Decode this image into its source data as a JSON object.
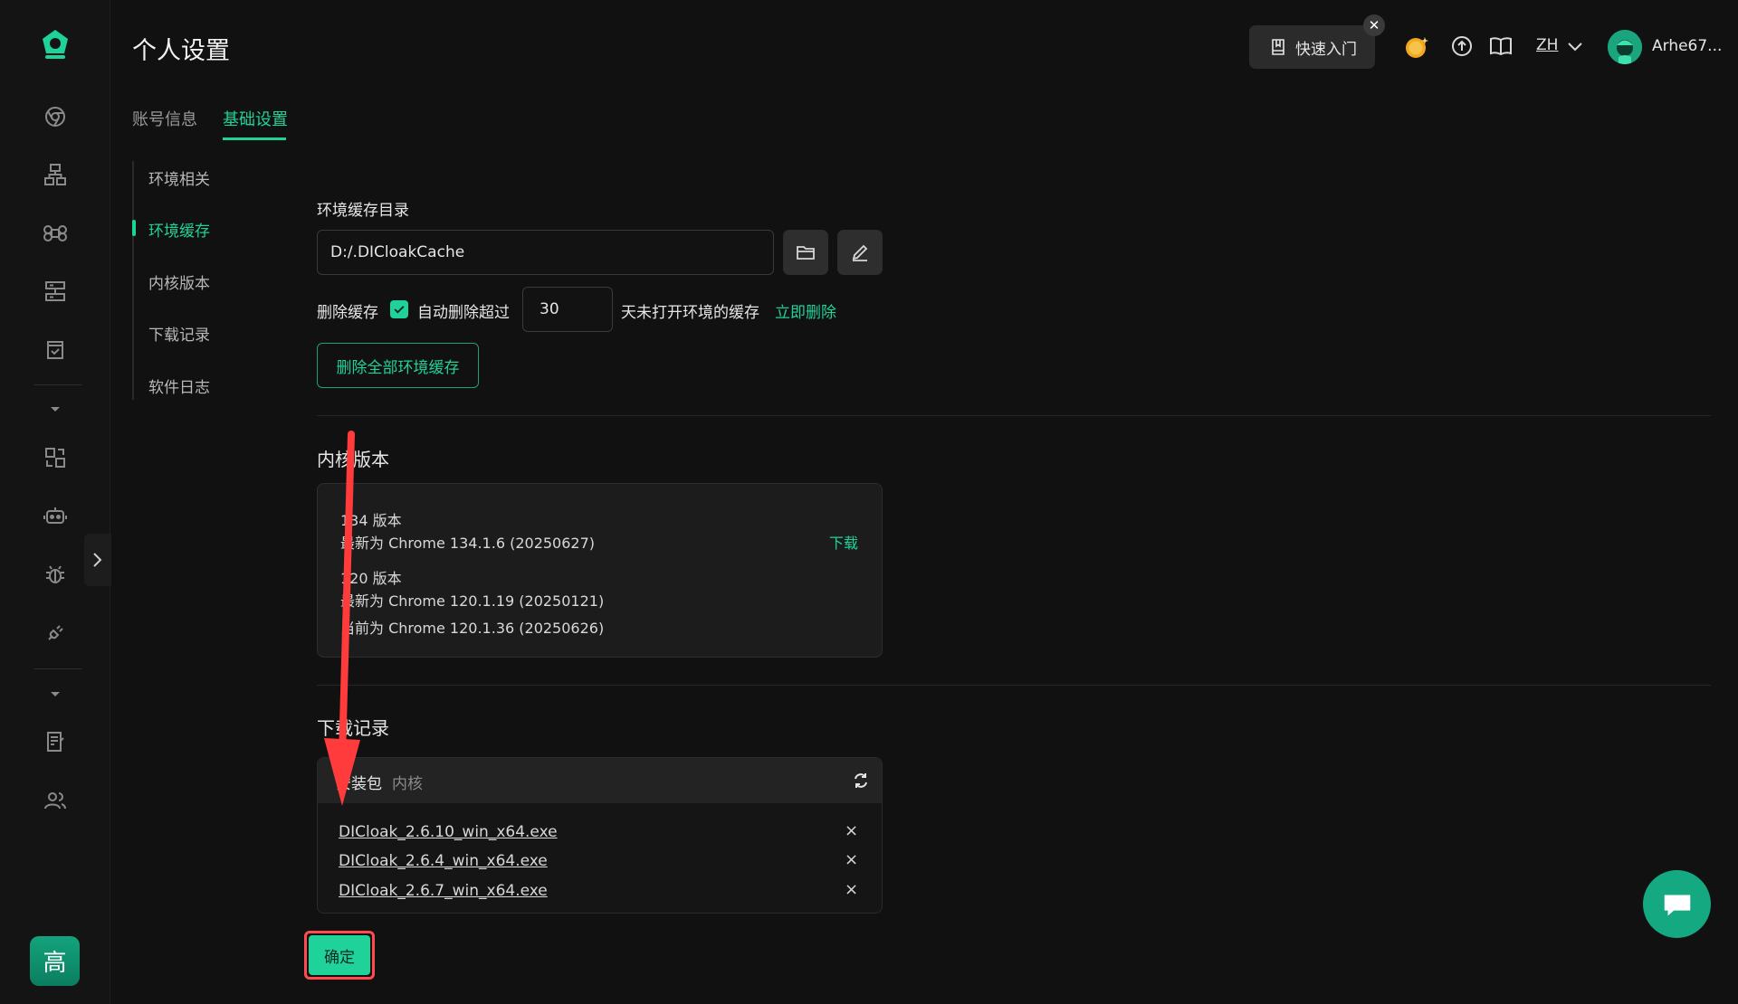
{
  "app": {
    "page_title": "个人设置",
    "accent_color": "#1fd29a",
    "alert_color": "#ff4b4b"
  },
  "rail": {
    "icons": [
      "logo-icon",
      "browser-icon",
      "network-icon",
      "command-icon",
      "server-icon",
      "shop-icon",
      "caret-down-icon",
      "sync-icon",
      "robot-icon",
      "bug-icon",
      "plug-icon",
      "caret-down-icon",
      "notes-icon",
      "team-icon"
    ],
    "user_initial": "高"
  },
  "header": {
    "quick_start": "快速入门",
    "quick_close": "✕",
    "language": "ZH",
    "username": "Arhe67..."
  },
  "tabs": [
    {
      "label": "账号信息",
      "active": false
    },
    {
      "label": "基础设置",
      "active": true
    }
  ],
  "subnav": [
    {
      "label": "环境相关",
      "active": false
    },
    {
      "label": "环境缓存",
      "active": true
    },
    {
      "label": "内核版本",
      "active": false
    },
    {
      "label": "下载记录",
      "active": false
    },
    {
      "label": "软件日志",
      "active": false
    }
  ],
  "cache": {
    "dir_label": "环境缓存目录",
    "dir_value": "D:/.DICloakCache",
    "delete_label": "删除缓存",
    "auto_delete_checked": true,
    "auto_delete_label": "自动删除超过",
    "days_value": "30",
    "days_suffix": "天未打开环境的缓存",
    "delete_now": "立即删除",
    "delete_all": "删除全部环境缓存"
  },
  "kernel": {
    "title": "内核版本",
    "versions": [
      {
        "name": "134 版本",
        "latest": "最新为 Chrome 134.1.6 (20250627)",
        "action": "下载"
      },
      {
        "name": "120 版本",
        "latest": "最新为 Chrome 120.1.19 (20250121)",
        "current": "当前为 Chrome 120.1.36 (20250626)"
      }
    ]
  },
  "downloads": {
    "title": "下载记录",
    "tabs": [
      {
        "label": "安装包",
        "active": true
      },
      {
        "label": "内核",
        "active": false
      }
    ],
    "refresh_icon": "refresh-icon",
    "files": [
      {
        "name": "DICloak_2.6.10_win_x64.exe",
        "remove": "×"
      },
      {
        "name": "DICloak_2.6.4_win_x64.exe",
        "remove": "×"
      },
      {
        "name": "DICloak_2.6.7_win_x64.exe",
        "remove": "×"
      }
    ]
  },
  "confirm_label": "确定"
}
